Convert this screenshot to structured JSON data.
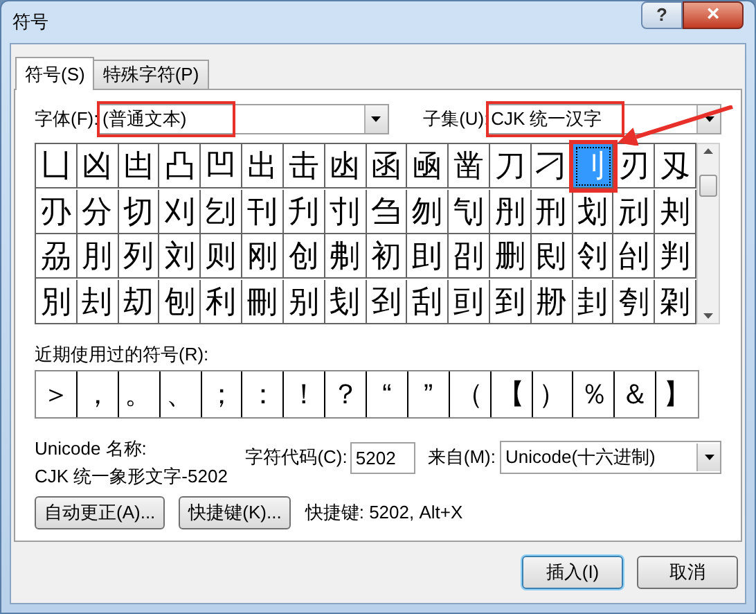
{
  "window": {
    "title": "符号",
    "buttons": [
      {
        "kind": "help",
        "label": "?"
      },
      {
        "kind": "close",
        "label": "×"
      }
    ]
  },
  "tabs": [
    {
      "label": "符号(S)",
      "selected": true
    },
    {
      "label": "特殊字符(P)",
      "selected": false
    }
  ],
  "font": {
    "label": "字体(F):",
    "value": "(普通文本)",
    "highlighted": true
  },
  "subset": {
    "label": "子集(U):",
    "value": "CJK 统一汉字",
    "highlighted": true
  },
  "symbols": [
    {
      "char": "凵",
      "selected": false
    },
    {
      "char": "凶",
      "selected": false
    },
    {
      "char": "凷",
      "selected": false
    },
    {
      "char": "凸",
      "selected": false
    },
    {
      "char": "凹",
      "selected": false
    },
    {
      "char": "出",
      "selected": false
    },
    {
      "char": "击",
      "selected": false
    },
    {
      "char": "凼",
      "selected": false
    },
    {
      "char": "函",
      "selected": false
    },
    {
      "char": "凾",
      "selected": false
    },
    {
      "char": "凿",
      "selected": false
    },
    {
      "char": "刀",
      "selected": false
    },
    {
      "char": "刁",
      "selected": false
    },
    {
      "char": "刂",
      "selected": true,
      "highlighted": true
    },
    {
      "char": "刃",
      "selected": false
    },
    {
      "char": "刄",
      "selected": false
    },
    {
      "char": "刅",
      "selected": false
    },
    {
      "char": "分",
      "selected": false
    },
    {
      "char": "切",
      "selected": false
    },
    {
      "char": "刈",
      "selected": false
    },
    {
      "char": "刉",
      "selected": false
    },
    {
      "char": "刊",
      "selected": false
    },
    {
      "char": "刋",
      "selected": false
    },
    {
      "char": "刌",
      "selected": false
    },
    {
      "char": "刍",
      "selected": false
    },
    {
      "char": "刎",
      "selected": false
    },
    {
      "char": "刏",
      "selected": false
    },
    {
      "char": "刐",
      "selected": false
    },
    {
      "char": "刑",
      "selected": false
    },
    {
      "char": "划",
      "selected": false
    },
    {
      "char": "刓",
      "selected": false
    },
    {
      "char": "刔",
      "selected": false
    },
    {
      "char": "刕",
      "selected": false
    },
    {
      "char": "刖",
      "selected": false
    },
    {
      "char": "列",
      "selected": false
    },
    {
      "char": "刘",
      "selected": false
    },
    {
      "char": "则",
      "selected": false
    },
    {
      "char": "刚",
      "selected": false
    },
    {
      "char": "创",
      "selected": false
    },
    {
      "char": "刜",
      "selected": false
    },
    {
      "char": "初",
      "selected": false
    },
    {
      "char": "刞",
      "selected": false
    },
    {
      "char": "刟",
      "selected": false
    },
    {
      "char": "删",
      "selected": false
    },
    {
      "char": "刡",
      "selected": false
    },
    {
      "char": "刢",
      "selected": false
    },
    {
      "char": "刣",
      "selected": false
    },
    {
      "char": "判",
      "selected": false
    },
    {
      "char": "別",
      "selected": false
    },
    {
      "char": "刦",
      "selected": false
    },
    {
      "char": "刧",
      "selected": false
    },
    {
      "char": "刨",
      "selected": false
    },
    {
      "char": "利",
      "selected": false
    },
    {
      "char": "刪",
      "selected": false
    },
    {
      "char": "别",
      "selected": false
    },
    {
      "char": "刬",
      "selected": false
    },
    {
      "char": "刭",
      "selected": false
    },
    {
      "char": "刮",
      "selected": false
    },
    {
      "char": "刯",
      "selected": false
    },
    {
      "char": "到",
      "selected": false
    },
    {
      "char": "刱",
      "selected": false
    },
    {
      "char": "刲",
      "selected": false
    },
    {
      "char": "刳",
      "selected": false
    },
    {
      "char": "刴",
      "selected": false
    }
  ],
  "recent": {
    "label": "近期使用过的符号(R):",
    "symbols": [
      "＞",
      "，",
      "。",
      "、",
      "；",
      "：",
      "！",
      "？",
      "“",
      "”",
      "（",
      "【",
      "）",
      "％",
      "＆",
      "】"
    ]
  },
  "unicode_name": {
    "label": "Unicode 名称:",
    "value": "CJK 统一象形文字-5202"
  },
  "char_code": {
    "label": "字符代码(C):",
    "value": "5202"
  },
  "from": {
    "label": "来自(M):",
    "value": "Unicode(十六进制)"
  },
  "autocorrect_button": "自动更正(A)...",
  "shortcut_button": "快捷键(K)...",
  "shortcut_text": "快捷键: 5202, Alt+X",
  "footer_buttons": [
    {
      "label": "插入(I)",
      "default": true
    },
    {
      "label": "取消",
      "default": false
    }
  ]
}
